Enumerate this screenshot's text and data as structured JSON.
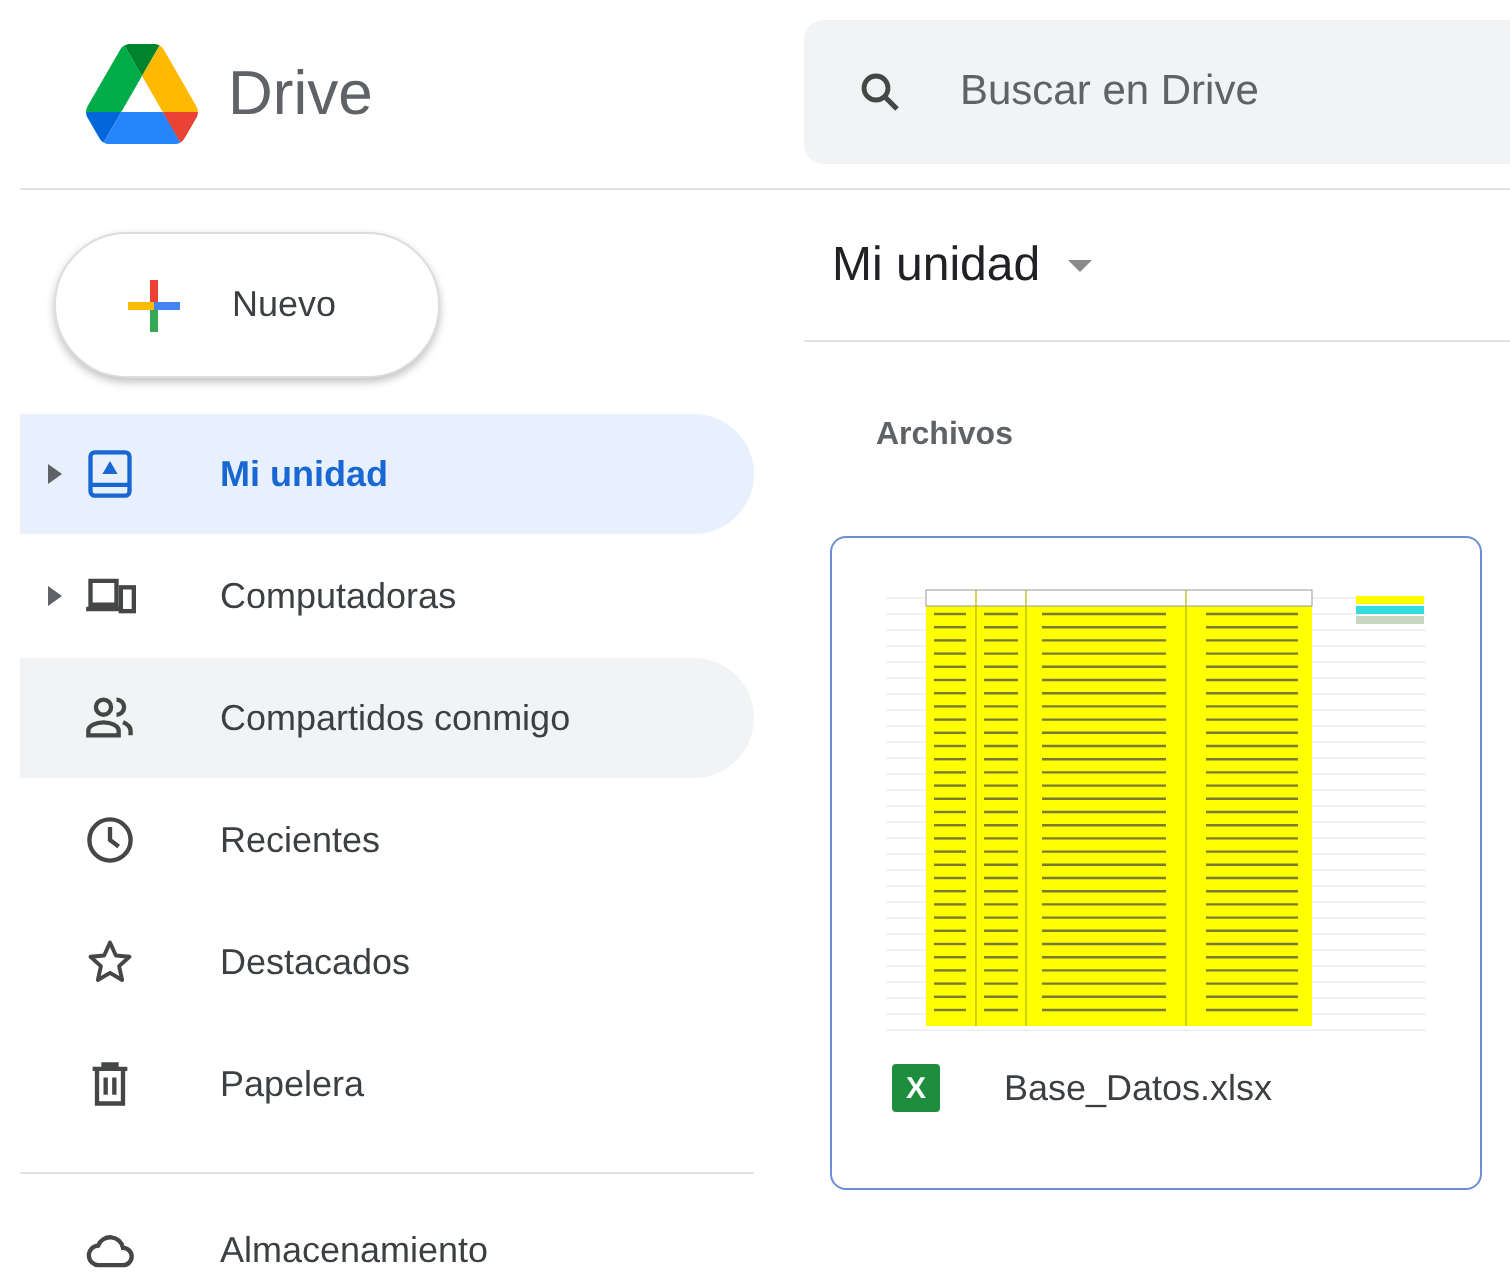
{
  "app": {
    "title": "Drive"
  },
  "search": {
    "placeholder": "Buscar en Drive"
  },
  "new_button": {
    "label": "Nuevo"
  },
  "sidebar": {
    "items": [
      {
        "label": "Mi unidad",
        "selected": true,
        "hovered": false,
        "expandable": true
      },
      {
        "label": "Computadoras",
        "selected": false,
        "hovered": false,
        "expandable": true
      },
      {
        "label": "Compartidos conmigo",
        "selected": false,
        "hovered": true,
        "expandable": false
      },
      {
        "label": "Recientes",
        "selected": false,
        "hovered": false,
        "expandable": false
      },
      {
        "label": "Destacados",
        "selected": false,
        "hovered": false,
        "expandable": false
      },
      {
        "label": "Papelera",
        "selected": false,
        "hovered": false,
        "expandable": false
      }
    ],
    "storage": {
      "label": "Almacenamiento"
    }
  },
  "location": {
    "title": "Mi unidad"
  },
  "section": {
    "title": "Archivos"
  },
  "files": [
    {
      "name": "Base_Datos.xlsx",
      "selected": true,
      "icon_text": "X"
    }
  ]
}
